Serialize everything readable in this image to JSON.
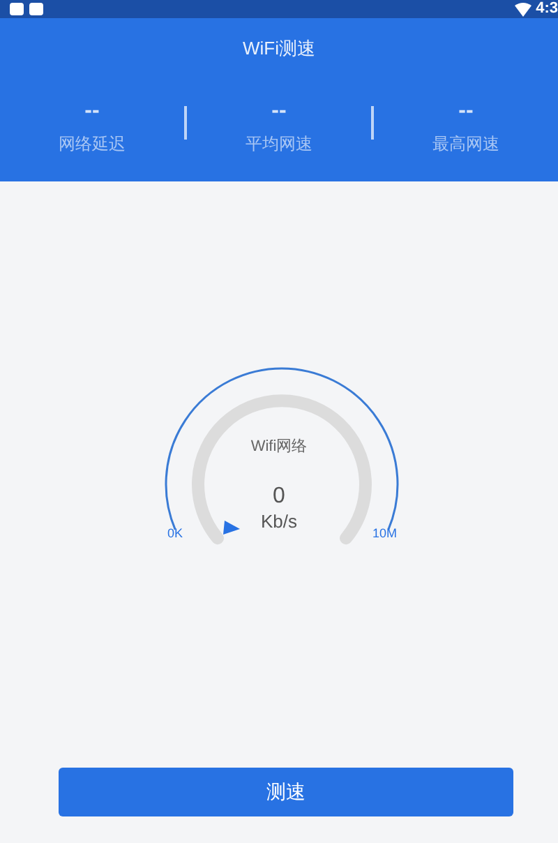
{
  "status_bar": {
    "time": "4:3"
  },
  "header": {
    "title": "WiFi测速"
  },
  "stats": [
    {
      "value": "--",
      "label": "网络延迟"
    },
    {
      "value": "--",
      "label": "平均网速"
    },
    {
      "value": "--",
      "label": "最高网速"
    }
  ],
  "gauge": {
    "network": "Wifi网络",
    "speed": "0",
    "unit": "Kb/s",
    "min_label": "0K",
    "max_label": "10M"
  },
  "button": {
    "label": "测速"
  }
}
